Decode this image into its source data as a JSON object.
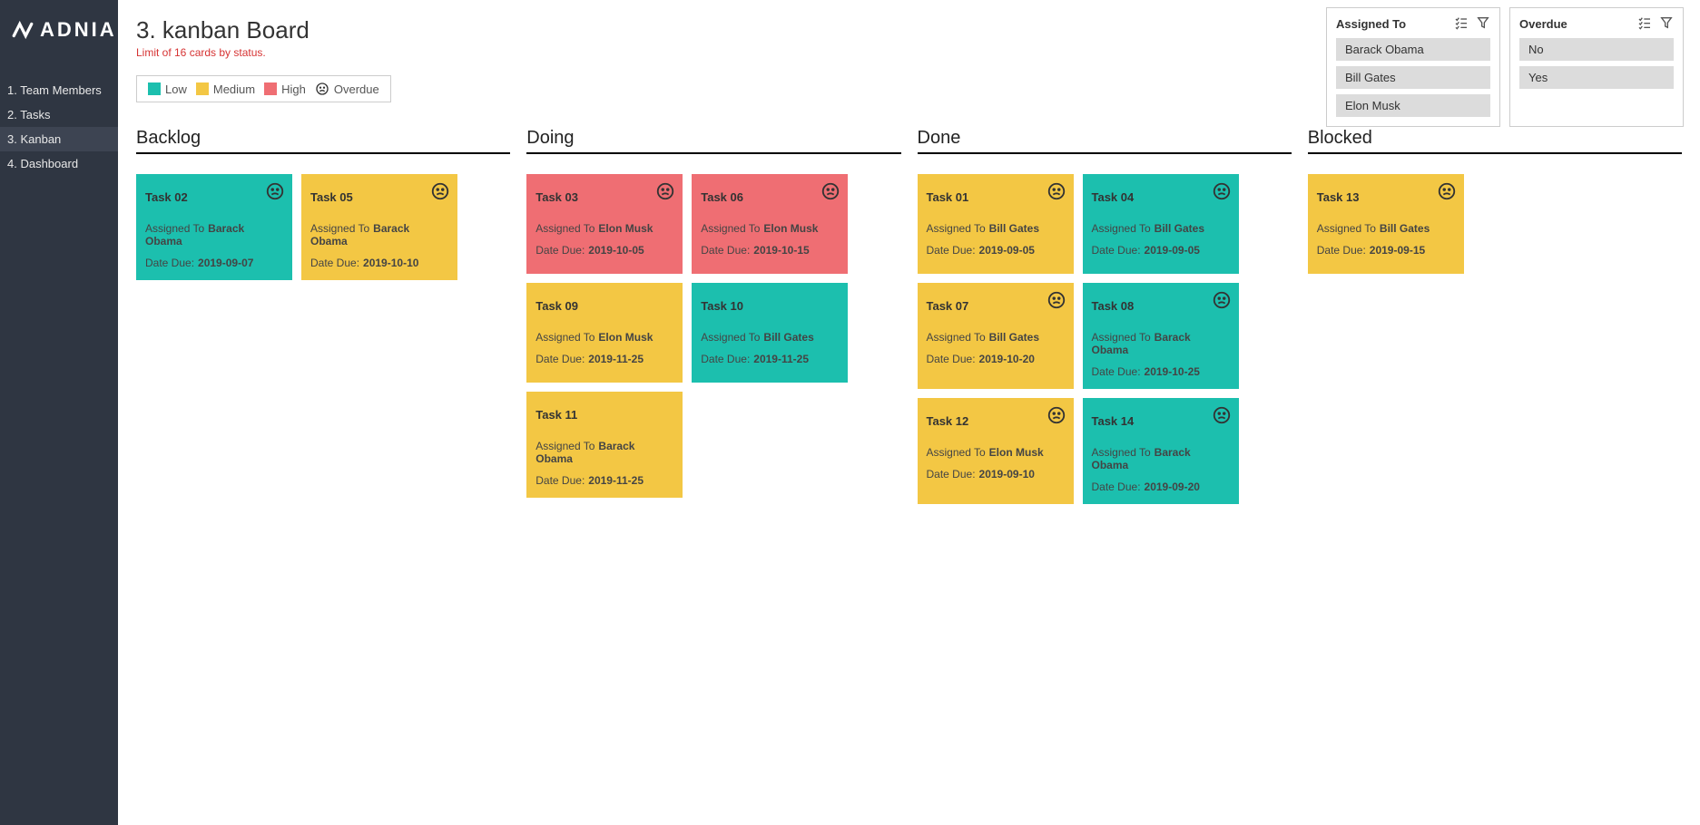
{
  "brand": "ADNIA",
  "sidebar": {
    "items": [
      {
        "label": "1. Team Members",
        "active": false
      },
      {
        "label": "2. Tasks",
        "active": false
      },
      {
        "label": "3. Kanban",
        "active": true
      },
      {
        "label": "4. Dashboard",
        "active": false
      }
    ]
  },
  "header": {
    "title": "3. kanban Board",
    "limit": "Limit of 16 cards by status."
  },
  "legend": {
    "low": "Low",
    "medium": "Medium",
    "high": "High",
    "overdue": "Overdue"
  },
  "labels": {
    "assigned_to": "Assigned To",
    "date_due": "Date Due:"
  },
  "filters": {
    "assigned_to": {
      "title": "Assigned To",
      "options": [
        "Barack Obama",
        "Bill Gates",
        "Elon Musk"
      ]
    },
    "overdue": {
      "title": "Overdue",
      "options": [
        "No",
        "Yes"
      ]
    }
  },
  "columns": [
    {
      "title": "Backlog",
      "cards": [
        {
          "name": "Task 02",
          "priority": "low",
          "overdue": true,
          "assigned": "Barack Obama",
          "due": "2019-09-07"
        },
        {
          "name": "Task 05",
          "priority": "medium",
          "overdue": true,
          "assigned": "Barack Obama",
          "due": "2019-10-10"
        }
      ]
    },
    {
      "title": "Doing",
      "cards": [
        {
          "name": "Task 03",
          "priority": "high",
          "overdue": true,
          "assigned": "Elon Musk",
          "due": "2019-10-05"
        },
        {
          "name": "Task 06",
          "priority": "high",
          "overdue": true,
          "assigned": "Elon Musk",
          "due": "2019-10-15"
        },
        {
          "name": "Task 09",
          "priority": "medium",
          "overdue": false,
          "assigned": "Elon Musk",
          "due": "2019-11-25"
        },
        {
          "name": "Task 10",
          "priority": "low",
          "overdue": false,
          "assigned": "Bill Gates",
          "due": "2019-11-25"
        },
        {
          "name": "Task 11",
          "priority": "medium",
          "overdue": false,
          "assigned": "Barack Obama",
          "due": "2019-11-25"
        }
      ]
    },
    {
      "title": "Done",
      "cards": [
        {
          "name": "Task 01",
          "priority": "medium",
          "overdue": true,
          "assigned": "Bill Gates",
          "due": "2019-09-05"
        },
        {
          "name": "Task 04",
          "priority": "low",
          "overdue": true,
          "assigned": "Bill Gates",
          "due": "2019-09-05"
        },
        {
          "name": "Task 07",
          "priority": "medium",
          "overdue": true,
          "assigned": "Bill Gates",
          "due": "2019-10-20"
        },
        {
          "name": "Task 08",
          "priority": "low",
          "overdue": true,
          "assigned": "Barack Obama",
          "due": "2019-10-25"
        },
        {
          "name": "Task 12",
          "priority": "medium",
          "overdue": true,
          "assigned": "Elon Musk",
          "due": "2019-09-10"
        },
        {
          "name": "Task 14",
          "priority": "low",
          "overdue": true,
          "assigned": "Barack Obama",
          "due": "2019-09-20"
        }
      ]
    },
    {
      "title": "Blocked",
      "cards": [
        {
          "name": "Task 13",
          "priority": "medium",
          "overdue": true,
          "assigned": "Bill Gates",
          "due": "2019-09-15"
        }
      ]
    }
  ]
}
